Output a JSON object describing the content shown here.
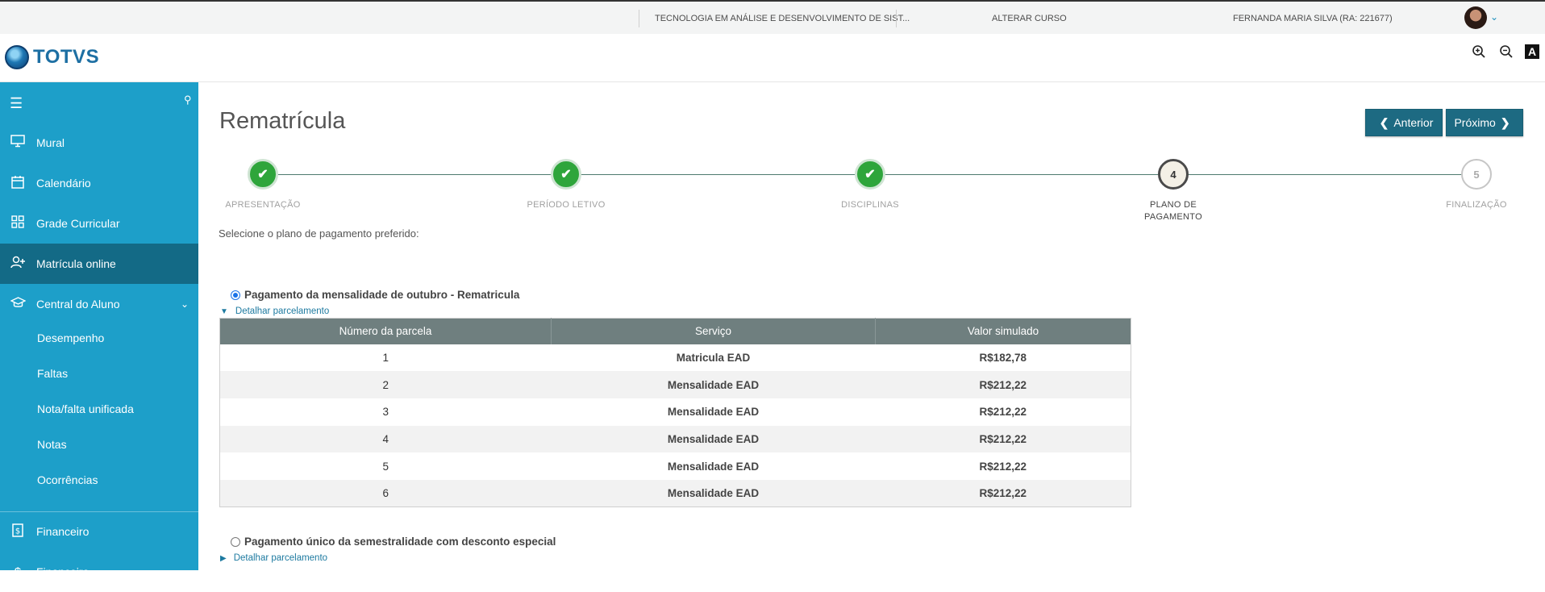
{
  "topbar": {
    "course": "TECNOLOGIA EM ANÁLISE E DESENVOLVIMENTO DE SIST...",
    "change_course": "ALTERAR CURSO",
    "user": "FERNANDA MARIA SILVA (RA: 221677)"
  },
  "header": {
    "brand": "TOTVS",
    "zoom_in_icon": "zoom-in-icon",
    "zoom_out_icon": "zoom-out-icon",
    "contrast_icon": "contrast-icon",
    "contrast_glyph": "A"
  },
  "sidebar": {
    "items": [
      {
        "label": "Mural",
        "icon": "monitor-icon"
      },
      {
        "label": "Calendário",
        "icon": "calendar-icon"
      },
      {
        "label": "Grade Curricular",
        "icon": "grid-icon"
      },
      {
        "label": "Matrícula online",
        "icon": "user-add-icon",
        "active": true
      },
      {
        "label": "Central do Aluno",
        "icon": "graduation-cap-icon"
      }
    ],
    "sub_items": [
      "Desempenho",
      "Faltas",
      "Nota/falta unificada",
      "Notas",
      "Ocorrências"
    ],
    "financeiro": "Financeiro",
    "next_partial": "Financeiro"
  },
  "page": {
    "title": "Rematrícula",
    "prev_label": "Anterior",
    "next_label": "Próximo",
    "steps": [
      {
        "n": "1",
        "label": "APRESENTAÇÃO",
        "state": "done"
      },
      {
        "n": "2",
        "label": "PERÍODO LETIVO",
        "state": "done"
      },
      {
        "n": "3",
        "label": "DISCIPLINAS",
        "state": "done"
      },
      {
        "n": "4",
        "label": "PLANO DE\nPAGAMENTO",
        "state": "current"
      },
      {
        "n": "5",
        "label": "FINALIZAÇÃO",
        "state": "todo"
      }
    ],
    "instruction": "Selecione o plano de pagamento preferido:",
    "plan1": "Pagamento da mensalidade de outubro - Rematricula",
    "plan2": "Pagamento único da semestralidade com desconto especial",
    "detail_label": "Detalhar parcelamento",
    "table": {
      "headers": [
        "Número da parcela",
        "Serviço",
        "Valor simulado"
      ],
      "rows": [
        [
          "1",
          "Matricula EAD",
          "R$182,78"
        ],
        [
          "2",
          "Mensalidade EAD",
          "R$212,22"
        ],
        [
          "3",
          "Mensalidade EAD",
          "R$212,22"
        ],
        [
          "4",
          "Mensalidade EAD",
          "R$212,22"
        ],
        [
          "5",
          "Mensalidade EAD",
          "R$212,22"
        ],
        [
          "6",
          "Mensalidade EAD",
          "R$212,22"
        ]
      ]
    }
  },
  "colors": {
    "sidebar": "#1d9fc9",
    "sidebar_active": "#136a86",
    "button": "#1d6a82",
    "step_done": "#2ea53b",
    "table_header": "#6f7f7f"
  }
}
